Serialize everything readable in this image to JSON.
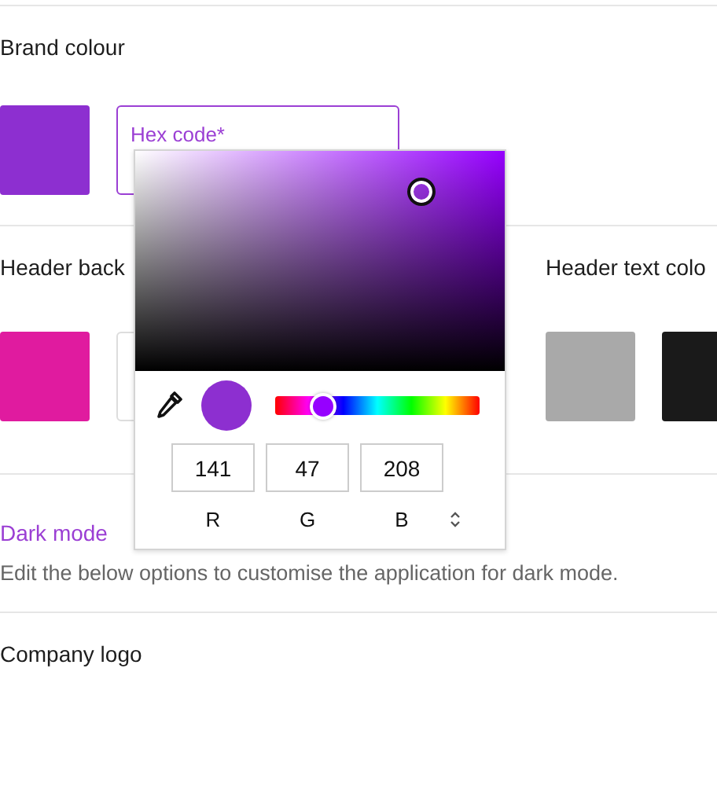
{
  "brand": {
    "title": "Brand colour",
    "swatch": {
      "color": "#8d2fd0"
    },
    "field": {
      "label": "Hex code*",
      "focused": true
    }
  },
  "header": {
    "background": {
      "title": "Header back",
      "swatch": {
        "color": "#e01b9f"
      }
    },
    "text": {
      "title": "Header text colo",
      "swatches": [
        {
          "color": "#a9a9a9"
        },
        {
          "color": "#1a1a1a"
        }
      ]
    }
  },
  "dark_mode": {
    "title": "Dark mode",
    "description": "Edit the below options to customise the application for dark mode."
  },
  "company_logo": {
    "title": "Company logo"
  },
  "color_picker": {
    "hue_slider": {
      "level": 0.235
    },
    "channels": [
      {
        "label": "R",
        "value": "141"
      },
      {
        "label": "G",
        "value": "47"
      },
      {
        "label": "B",
        "value": "208"
      }
    ]
  }
}
